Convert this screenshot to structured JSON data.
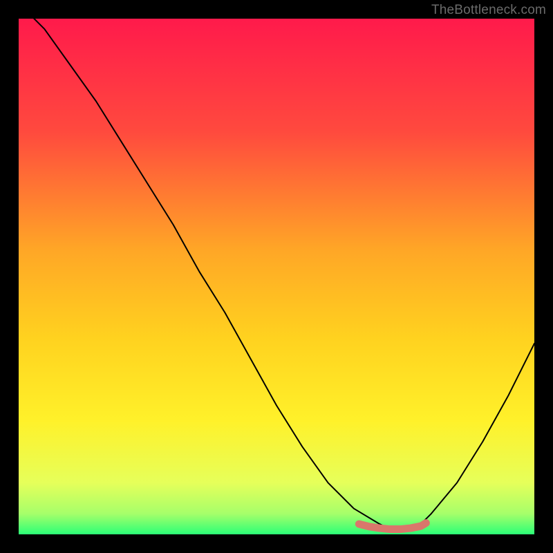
{
  "watermark": "TheBottleneck.com",
  "colors": {
    "black": "#000000",
    "curve": "#000000",
    "trough_marker": "#d9776b",
    "gradient_stops": [
      {
        "pos": 0.0,
        "color": "#ff1a4b"
      },
      {
        "pos": 0.22,
        "color": "#ff4a3e"
      },
      {
        "pos": 0.45,
        "color": "#ffa726"
      },
      {
        "pos": 0.62,
        "color": "#ffd21f"
      },
      {
        "pos": 0.78,
        "color": "#fff12a"
      },
      {
        "pos": 0.9,
        "color": "#e6ff5a"
      },
      {
        "pos": 0.96,
        "color": "#a6ff6a"
      },
      {
        "pos": 1.0,
        "color": "#2bff77"
      }
    ]
  },
  "chart_data": {
    "type": "line",
    "title": "",
    "xlabel": "",
    "ylabel": "",
    "xlim": [
      0,
      100
    ],
    "ylim": [
      0,
      100
    ],
    "series": [
      {
        "name": "bottleneck-curve",
        "x": [
          0,
          5,
          10,
          15,
          20,
          25,
          30,
          35,
          40,
          45,
          50,
          55,
          60,
          65,
          70,
          72,
          75,
          78,
          80,
          85,
          90,
          95,
          100
        ],
        "y": [
          103,
          98,
          91,
          84,
          76,
          68,
          60,
          51,
          43,
          34,
          25,
          17,
          10,
          5,
          2,
          1,
          1,
          2,
          4,
          10,
          18,
          27,
          37
        ]
      },
      {
        "name": "trough-marker",
        "x": [
          66,
          68,
          70,
          72,
          74,
          76,
          78,
          79
        ],
        "y": [
          2.0,
          1.5,
          1.2,
          1.0,
          1.0,
          1.2,
          1.6,
          2.2
        ]
      }
    ]
  }
}
